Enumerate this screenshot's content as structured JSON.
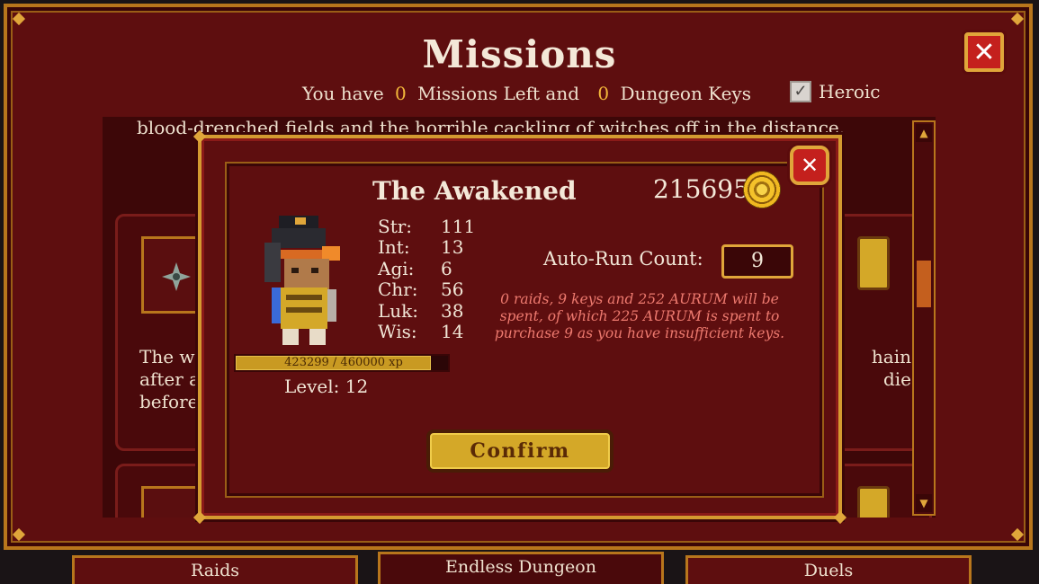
{
  "header": {
    "title": "Missions",
    "you_have": "You have",
    "missions_left_count": "0",
    "missions_left_label": "Missions Left and",
    "dungeon_keys_count": "0",
    "dungeon_keys_label": "Dungeon Keys",
    "heroic_label": "Heroic",
    "heroic_checked": true
  },
  "background_list": {
    "top_text": "blood-drenched fields and the horrible cackling of witches off in the distance.",
    "card_text_line1": "The wi",
    "card_text_line2": "after a",
    "card_text_line3": "before",
    "card_text_right1": "hain",
    "card_text_right2": "die"
  },
  "modal": {
    "character_name": "The Awakened",
    "gold": "215695",
    "stats": [
      {
        "name": "Str:",
        "value": "111"
      },
      {
        "name": "Int:",
        "value": "13"
      },
      {
        "name": "Agi:",
        "value": "6"
      },
      {
        "name": "Chr:",
        "value": "56"
      },
      {
        "name": "Luk:",
        "value": "38"
      },
      {
        "name": "Wis:",
        "value": "14"
      }
    ],
    "xp_text": "423299 / 460000 xp",
    "xp_fraction": 0.92,
    "level_label": "Level:",
    "level_value": "12",
    "auto_run_label": "Auto-Run Count:",
    "auto_run_value": "9",
    "note": "0 raids, 9 keys and 252 AURUM will be spent, of which 225 AURUM is spent to purchase 9 as you have insufficient keys.",
    "confirm_label": "Confirm"
  },
  "tabs": [
    "Raids",
    "Endless Dungeon",
    "Duels"
  ],
  "icons": {
    "close": "close-icon",
    "coin": "aurum-coin-icon",
    "checkmark": "check-icon"
  }
}
